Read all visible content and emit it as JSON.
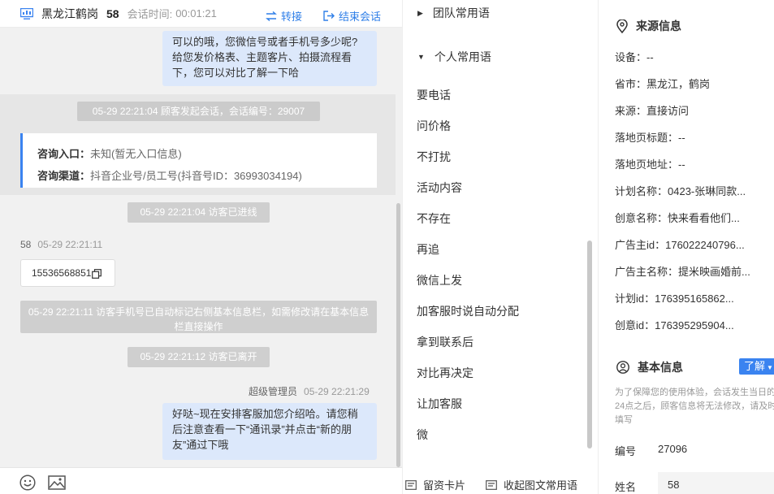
{
  "header": {
    "city": "黑龙江鹤岗",
    "visitor_id": "58",
    "time_label": "会话时间:",
    "time_value": "00:01:21",
    "transfer": "转接",
    "end_session": "结束会话"
  },
  "messages": {
    "agent_reply_1": [
      "可以的哦，您微信号或者手机号多少呢?",
      "给您发价格表、主题客片、拍摄流程看",
      "下，您可以对比了解一下哈"
    ],
    "sys_start": "05-29 22:21:04 顾客发起会话，会话编号：29007",
    "entry_label": "咨询入口：",
    "entry_value": "未知(暂无入口信息)",
    "channel_label": "咨询渠道：",
    "channel_value": "抖音企业号/员工号(抖音号ID：36993034194)",
    "sys_enter": "05-29 22:21:04 访客已进线",
    "visitor_name": "58",
    "visitor_time": "05-29 22:21:11",
    "visitor_phone": "15536568851",
    "sys_mark": "05-29 22:21:11 访客手机号已自动标记右侧基本信息栏，如需修改请在基本信息栏直接操作",
    "sys_leave": "05-29 22:21:12 访客已离开",
    "agent_name": "超级管理员",
    "agent_time": "05-29 22:21:29",
    "agent_reply_2": [
      "好哒~现在安排客服加您介绍哈。请您稍",
      "后注意查看一下“通讯录”并点击“新的朋",
      "友”通过下哦"
    ]
  },
  "phrases": {
    "team_group": "团队常用语",
    "personal_group": "个人常用语",
    "items": [
      "要电话",
      "问价格",
      "不打扰",
      "活动内容",
      "不存在",
      "再追",
      "微信上发",
      "加客服时说自动分配",
      "拿到联系后",
      "对比再决定",
      "让加客服",
      "微"
    ],
    "leave_card": "留资卡片",
    "collapse": "收起图文常用语"
  },
  "info": {
    "source_title": "来源信息",
    "rows": [
      "设备：--",
      "省市：黑龙江，鹤岗",
      "来源：直接访问",
      "落地页标题：--",
      "落地页地址：--",
      "计划名称：0423-张琳同款...",
      "创意名称：快来看看他们...",
      "广告主id：176022240796...",
      "广告主名称：提米映画婚前...",
      "计划id：176395165862...",
      "创意id：176395295904..."
    ],
    "basic_title": "基本信息",
    "know_btn": "了解",
    "note": "为了保障您的使用体验，会话发生当日的24点之后，顾客信息将无法修改，请及时填写",
    "id_label": "编号",
    "id_value": "27096",
    "name_label": "姓名",
    "name_value": "58"
  },
  "colors": {
    "accent": "#2f7fe8",
    "bubble": "#dce8fb",
    "system": "#cfcfcf"
  }
}
